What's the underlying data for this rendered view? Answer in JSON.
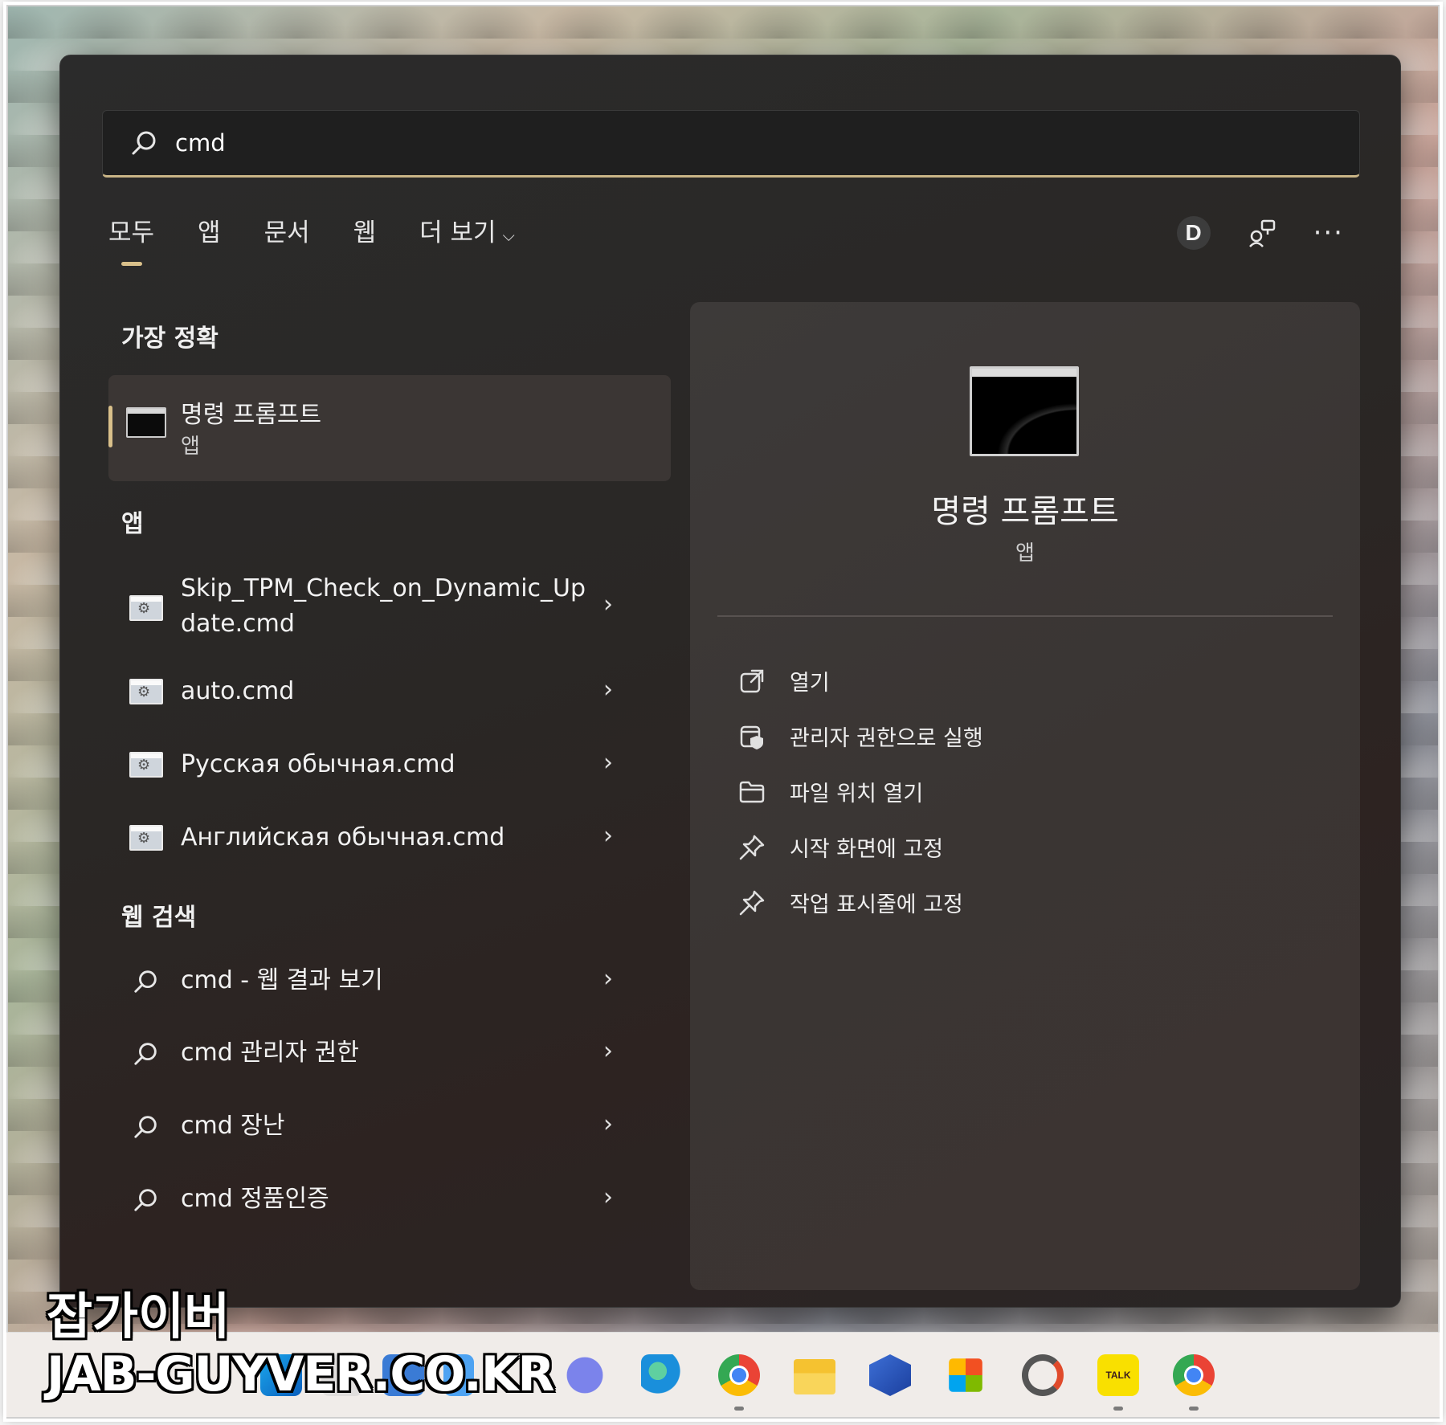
{
  "search": {
    "query": "cmd"
  },
  "tabs": [
    {
      "label": "모두"
    },
    {
      "label": "앱"
    },
    {
      "label": "문서"
    },
    {
      "label": "웹"
    },
    {
      "label": "더 보기"
    }
  ],
  "account_initial": "D",
  "more_glyph": "···",
  "best_match": {
    "section": "가장 정확",
    "title": "명령 프롬프트",
    "subtitle": "앱"
  },
  "apps": {
    "section": "앱",
    "items": [
      {
        "line1": "Skip_TPM_Check_on_Dynamic_Up",
        "line2": "date.cmd"
      },
      {
        "line1": "auto.cmd"
      },
      {
        "line1": "Русская обычная.cmd"
      },
      {
        "line1": "Английская обычная.cmd"
      }
    ]
  },
  "web": {
    "section": "웹 검색",
    "items": [
      {
        "label": "cmd - 웹 결과 보기"
      },
      {
        "label": "cmd 관리자 권한"
      },
      {
        "label": "cmd 장난"
      },
      {
        "label": "cmd 정품인증"
      }
    ]
  },
  "detail": {
    "title": "명령 프롬프트",
    "subtitle": "앱",
    "actions": [
      {
        "label": "열기",
        "icon": "open-external-icon"
      },
      {
        "label": "관리자 권한으로 실행",
        "icon": "shield-run-icon"
      },
      {
        "label": "파일 위치 열기",
        "icon": "folder-icon"
      },
      {
        "label": "시작 화면에 고정",
        "icon": "pin-icon"
      },
      {
        "label": "작업 표시줄에 고정",
        "icon": "pin-icon"
      }
    ]
  },
  "taskbar": {
    "apps": [
      "start-icon",
      "teams-icon",
      "edge-icon",
      "chrome-icon",
      "file-explorer-icon",
      "keypass-icon",
      "store-icon",
      "sync-icon",
      "kakaotalk-icon",
      "chrome-profile-icon"
    ],
    "kakao_label": "TALK"
  },
  "watermark": {
    "line1": "잡가이버",
    "line2": "JAB-GUYVER.CO.KR"
  },
  "colors": {
    "accent": "#d9c08a",
    "panel": "#2b2827",
    "detail_panel": "#3b3735"
  },
  "arrow_glyph": "›"
}
